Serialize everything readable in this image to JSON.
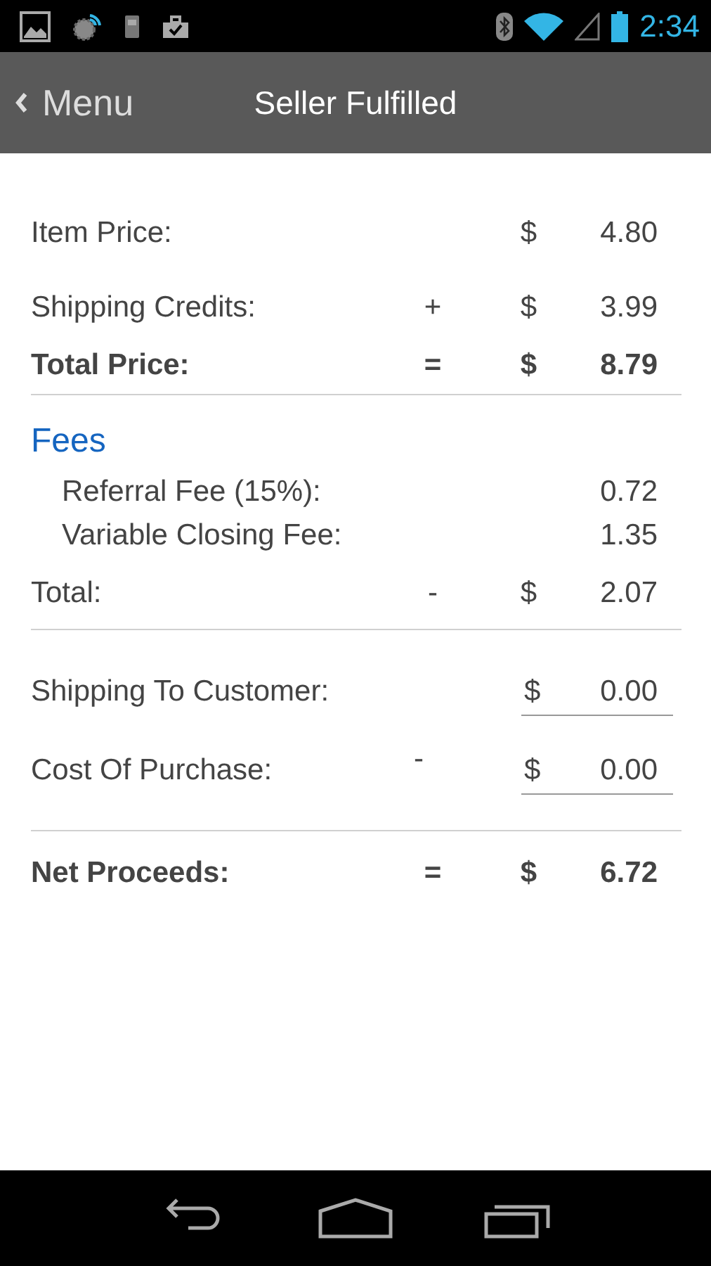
{
  "status_bar": {
    "time": "2:34"
  },
  "header": {
    "back_label": "Menu",
    "title": "Seller Fulfilled"
  },
  "items": [
    {
      "kind": "line",
      "label": "Item Price:",
      "currency": "$",
      "value": "4.80"
    },
    {
      "kind": "line",
      "label": "Shipping Credits:",
      "operator": "+",
      "currency": "$",
      "value": "3.99"
    },
    {
      "kind": "total",
      "label": "Total Price:",
      "operator": "=",
      "currency": "$",
      "value": "8.79"
    },
    {
      "kind": "divider"
    },
    {
      "kind": "heading",
      "label": "Fees"
    },
    {
      "kind": "sub",
      "label": "Referral Fee (15%):",
      "value": "0.72"
    },
    {
      "kind": "sub",
      "label": "Variable Closing Fee:",
      "value": "1.35"
    },
    {
      "kind": "line",
      "label": "Total:",
      "operator": "-",
      "currency": "$",
      "value": "2.07"
    },
    {
      "kind": "divider"
    },
    {
      "kind": "field",
      "label": "Shipping To Customer:",
      "currency": "$",
      "value": "0.00"
    },
    {
      "kind": "field",
      "label": "Cost Of Purchase:",
      "operator": "-",
      "currency": "$",
      "value": "0.00"
    },
    {
      "kind": "divider"
    },
    {
      "kind": "total",
      "label": "Net Proceeds:",
      "operator": "=",
      "currency": "$",
      "value": "6.72"
    }
  ]
}
